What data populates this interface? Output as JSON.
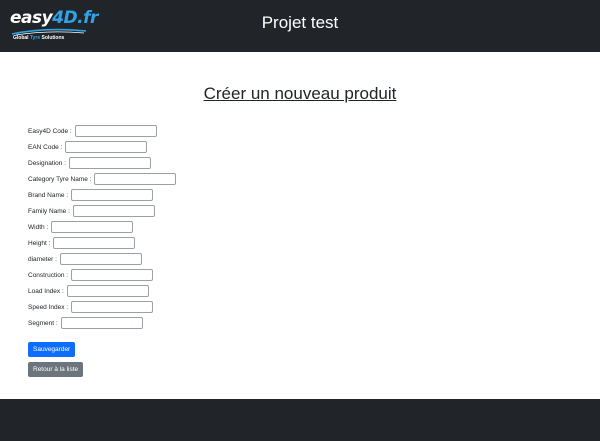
{
  "header": {
    "logo_text_main": "easy",
    "logo_text_accent": "4D.fr",
    "logo_tagline_a": "Global ",
    "logo_tagline_b": "Tyre",
    "logo_tagline_c": " Solutions",
    "title": "Projet test"
  },
  "page": {
    "heading": "Créer un nouveau produit"
  },
  "form": {
    "fields": [
      {
        "label": "Easy4D Code :",
        "value": ""
      },
      {
        "label": "EAN Code :",
        "value": ""
      },
      {
        "label": "Designation :",
        "value": ""
      },
      {
        "label": "Category Tyre Name :",
        "value": ""
      },
      {
        "label": "Brand Name :",
        "value": ""
      },
      {
        "label": "Family Name :",
        "value": ""
      },
      {
        "label": "Width :",
        "value": ""
      },
      {
        "label": "Height :",
        "value": ""
      },
      {
        "label": "diameter :",
        "value": ""
      },
      {
        "label": "Construction :",
        "value": ""
      },
      {
        "label": "Load Index :",
        "value": ""
      },
      {
        "label": "Speed Index :",
        "value": ""
      },
      {
        "label": "Segment :",
        "value": ""
      }
    ],
    "save_label": "Sauvegarder",
    "back_label": "Retour à la liste"
  },
  "colors": {
    "header_bg": "#212529",
    "primary": "#0d6efd",
    "secondary": "#6c757d",
    "logo_accent": "#2fa3e6"
  }
}
